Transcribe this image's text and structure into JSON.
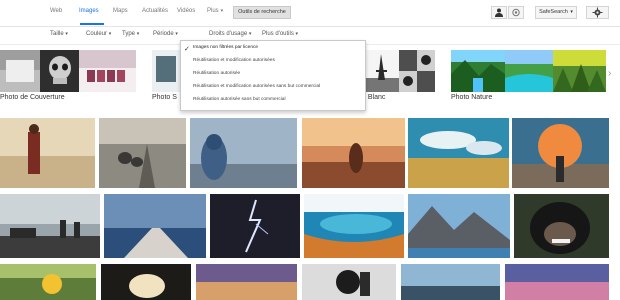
{
  "nav": {
    "tabs": [
      "Web",
      "Images",
      "Maps",
      "Actualités",
      "Vidéos",
      "Plus"
    ],
    "search_tools_label": "Outils de recherche",
    "safesearch_label": "SafeSearch",
    "colors": {
      "active_tab": "#1a73e8",
      "button_bg": "#e1e1e1",
      "button_border": "#c9c9c9"
    },
    "icons": [
      "person-icon",
      "view-mode-icon",
      "gear-icon"
    ]
  },
  "filters": {
    "items": [
      "Taille",
      "Couleur",
      "Type",
      "Période",
      "Droits d'usage",
      "Plus d'outils"
    ]
  },
  "suggestions": {
    "labels": [
      "Photo de Couverture",
      "Photo S",
      "t Blanc",
      "Photo Nature"
    ]
  },
  "usage_rights_menu": {
    "options": [
      "Images non filtrées par licence",
      "Réutilisation et modification autorisées",
      "Réutilisation autorisée",
      "Réutilisation et modification autorisées sans but commercial",
      "Réutilisation autorisée sans but commercial"
    ],
    "selected": "Images non filtrées par licence"
  },
  "results": {
    "row1": [
      "woman-field",
      "elephants-road",
      "photographer-hood",
      "woman-sunset-grass",
      "cloudy-field",
      "woman-powder"
    ],
    "row2": [
      "tank-silhouettes",
      "pier-blue-sky",
      "lightning-dark",
      "blue-lake",
      "mountain-lake",
      "monkey-selfie"
    ],
    "row3": [
      "yellow-flower",
      "cave-light",
      "sunset-sky",
      "man-jump-shadow",
      "sea-rocks",
      "purple-sky"
    ]
  }
}
